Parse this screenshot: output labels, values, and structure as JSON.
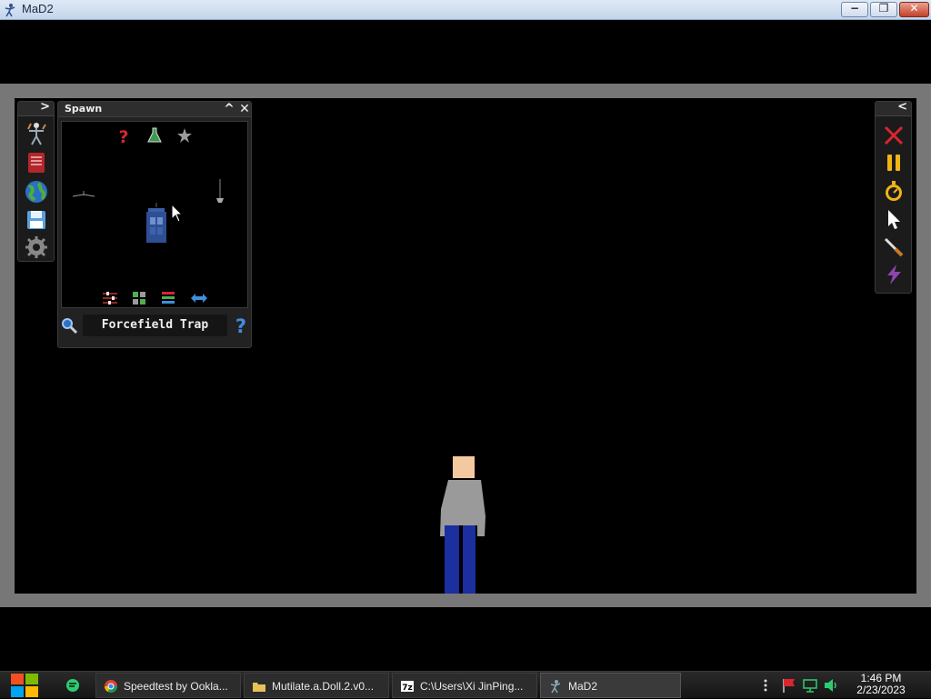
{
  "window": {
    "title": "MaD2",
    "minimize": "−",
    "maximize": "❐",
    "close": "✕"
  },
  "left_toolbar": {
    "collapse": ">",
    "tools": [
      "ragdoll-icon",
      "book-icon",
      "globe-icon",
      "save-icon",
      "gear-icon"
    ]
  },
  "spawn_panel": {
    "title": "Spawn",
    "collapse": "^",
    "close": "✕",
    "categories": [
      "question-icon",
      "flask-icon",
      "star-icon"
    ],
    "footer_buttons": [
      "sliders-icon",
      "grid-icon",
      "list-icon",
      "swap-arrows-icon"
    ],
    "search_value": "Forcefield Trap"
  },
  "right_toolbar": {
    "collapse": "<",
    "tools": [
      "close-x-icon",
      "pause-icon",
      "stopwatch-icon",
      "cursor-icon",
      "knife-icon",
      "lightning-icon"
    ]
  },
  "taskbar": {
    "items": [
      {
        "label": "Speedtest by Ookla...",
        "icon": "chrome-icon"
      },
      {
        "label": "Mutilate.a.Doll.2.v0...",
        "icon": "folder-icon"
      },
      {
        "label": "C:\\Users\\Xi JinPing...",
        "icon": "7zip-icon"
      },
      {
        "label": "MaD2",
        "icon": "mad2-icon"
      }
    ],
    "clock_time": "1:46 PM",
    "clock_date": "2/23/2023"
  },
  "colors": {
    "accent_red": "#d9262f",
    "accent_yellow": "#f0b416",
    "accent_blue": "#3f8ee0",
    "shirt_gray": "#9a9a9a",
    "pants_blue": "#1b2fa0",
    "skin": "#f4c9a0"
  }
}
